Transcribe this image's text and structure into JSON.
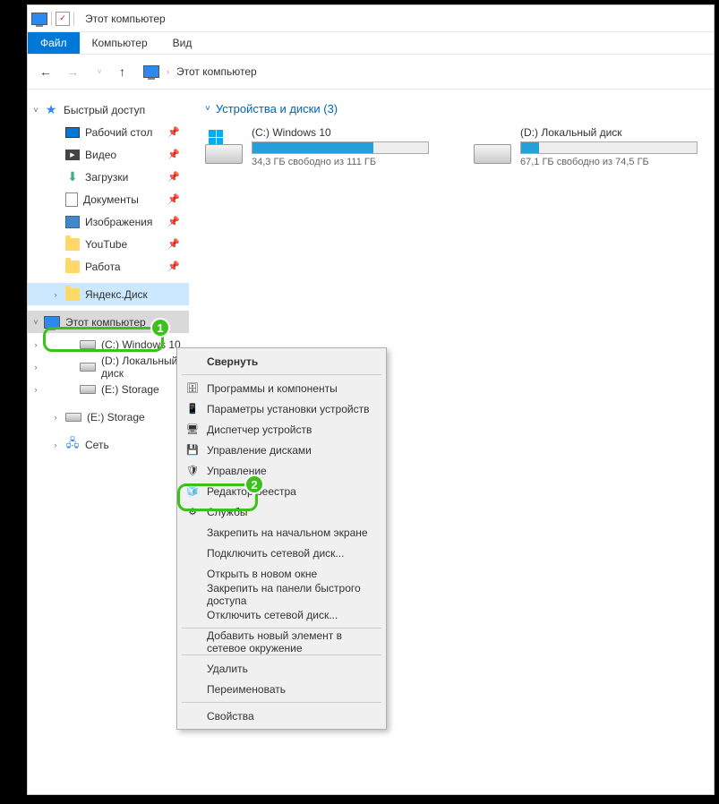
{
  "titlebar": {
    "title": "Этот компьютер"
  },
  "ribbon": {
    "file": "Файл",
    "computer": "Компьютер",
    "view": "Вид"
  },
  "address": {
    "location": "Этот компьютер"
  },
  "sidebar": {
    "quick_access": "Быстрый доступ",
    "desktop": "Рабочий стол",
    "video": "Видео",
    "downloads": "Загрузки",
    "documents": "Документы",
    "pictures": "Изображения",
    "youtube": "YouTube",
    "work": "Работа",
    "yandex_disk": "Яндекс.Диск",
    "this_pc": "Этот компьютер",
    "drive_c": "(C:) Windows 10",
    "drive_d": "(D:) Локальный диск",
    "drive_e": "(E:) Storage",
    "drive_e2": "(E:) Storage",
    "network": "Сеть"
  },
  "section": {
    "header": "Устройства и диски (3)"
  },
  "drives": [
    {
      "name": "(C:) Windows 10",
      "free_text": "34,3 ГБ свободно из 111 ГБ",
      "fill_pct": 69,
      "has_win_icon": true
    },
    {
      "name": "(D:) Локальный диск",
      "free_text": "67,1 ГБ свободно из 74,5 ГБ",
      "fill_pct": 10,
      "has_win_icon": false
    }
  ],
  "context_menu": {
    "collapse": "Свернуть",
    "programs": "Программы и компоненты",
    "device_params": "Параметры установки устройств",
    "device_mgr": "Диспетчер устройств",
    "disk_mgmt": "Управление дисками",
    "management": "Управление",
    "regedit": "Редактор реестра",
    "services": "Службы",
    "pin_start": "Закрепить на начальном экране",
    "map_drive": "Подключить сетевой диск...",
    "new_window": "Открыть в новом окне",
    "pin_quick": "Закрепить на панели быстрого доступа",
    "disconnect_drive": "Отключить сетевой диск...",
    "add_network": "Добавить новый элемент в сетевое окружение",
    "delete": "Удалить",
    "rename": "Переименовать",
    "properties": "Свойства"
  },
  "annotations": {
    "one": "1",
    "two": "2"
  }
}
